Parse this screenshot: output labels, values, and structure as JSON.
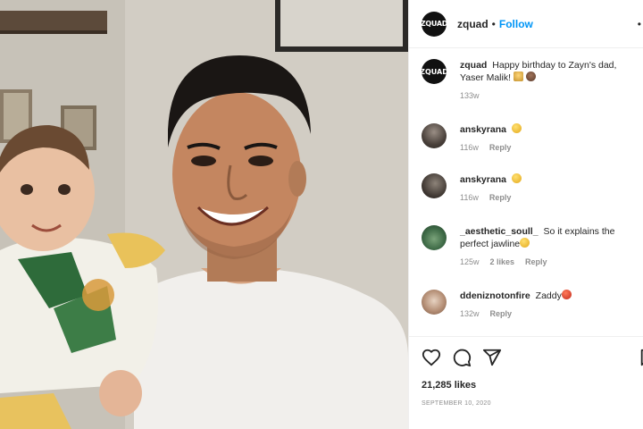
{
  "post": {
    "username": "zquad",
    "separator": "•",
    "follow_label": "Follow",
    "more_label": "•",
    "avatar_text": "ZQUAD",
    "caption": {
      "username": "zquad",
      "text": "Happy birthday to Zayn's dad, Yaser Malik!",
      "time": "133w",
      "emojis": [
        "gift-emoji",
        "cake-emoji"
      ]
    },
    "likes": "21,285 likes",
    "date": "SEPTEMBER 10, 2020"
  },
  "comments": [
    {
      "username": "anskyrana",
      "text": "",
      "emoji": "grin-emoji",
      "time": "116w",
      "likes": "",
      "reply": "Reply"
    },
    {
      "username": "anskyrana",
      "text": "",
      "emoji": "grin-emoji",
      "time": "116w",
      "likes": "",
      "reply": "Reply"
    },
    {
      "username": "_aesthetic_soull_",
      "text": "So it explains the perfect jawline",
      "emoji": "grin-emoji",
      "time": "125w",
      "likes": "2 likes",
      "reply": "Reply"
    },
    {
      "username": "ddeniznotonfire",
      "text": "Zaddy",
      "emoji": "red-face-emoji",
      "time": "132w",
      "likes": "",
      "reply": "Reply"
    }
  ],
  "icons": [
    "heart-icon",
    "comment-icon",
    "share-icon",
    "bookmark-icon"
  ],
  "colors": {
    "accent": "#0095f6",
    "text": "#262626",
    "muted": "#8e8e8e",
    "divider": "#efefef"
  }
}
